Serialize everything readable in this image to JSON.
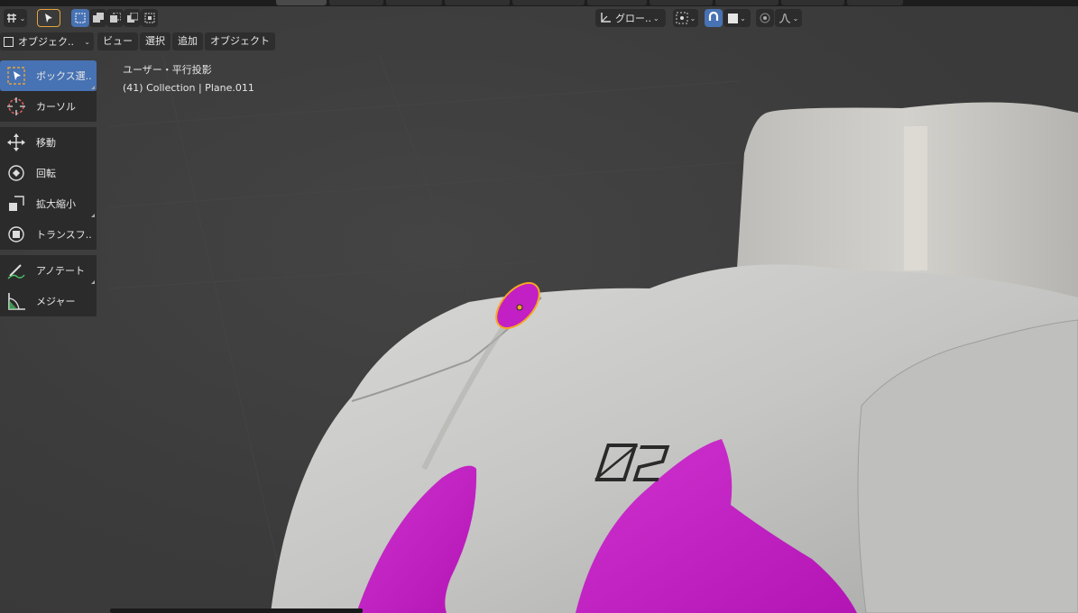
{
  "header": {
    "transform_orientation": "グロー..",
    "icons": [
      "editor-type-icon",
      "select-tool-icon",
      "select-mode-set-icon",
      "select-mode-extend-icon",
      "select-mode-subtract-icon",
      "select-mode-invert-icon",
      "select-mode-intersect-icon",
      "transform-orientation-icon",
      "pivot-point-icon",
      "snap-icon",
      "snap-target-icon",
      "proportional-edit-icon",
      "falloff-icon"
    ]
  },
  "menu": {
    "mode": "オブジェク..",
    "items": [
      "ビュー",
      "選択",
      "追加",
      "オブジェクト"
    ]
  },
  "toolbar": {
    "tools": [
      {
        "label": "ボックス選..",
        "icon": "box-select-icon",
        "active": true
      },
      {
        "label": "カーソル",
        "icon": "cursor-icon"
      },
      {
        "label": "移動",
        "icon": "move-icon"
      },
      {
        "label": "回転",
        "icon": "rotate-icon"
      },
      {
        "label": "拡大縮小",
        "icon": "scale-icon"
      },
      {
        "label": "トランスフ..",
        "icon": "transform-icon"
      },
      {
        "label": "アノテート",
        "icon": "annotate-icon"
      },
      {
        "label": "メジャー",
        "icon": "measure-icon"
      }
    ]
  },
  "viewport": {
    "view_name": "ユーザー・平行投影",
    "collection_info": "(41) Collection | Plane.011",
    "decal_text": "02",
    "colors": {
      "background": "#3d3d3d",
      "model": "#c9c9c7",
      "accent_mesh": "#c21fc4",
      "selection_outline": "#f5a623",
      "active_blue": "#4772b3"
    }
  }
}
